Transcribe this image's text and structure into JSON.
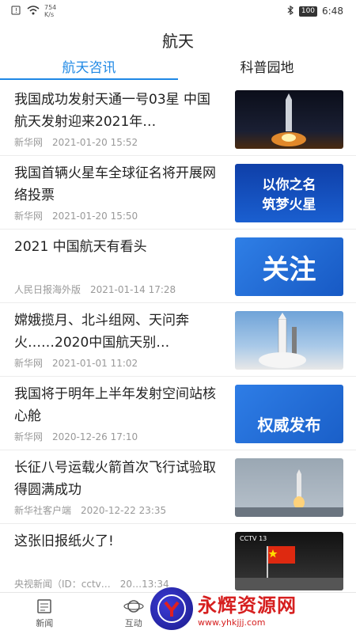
{
  "status": {
    "net_speed": "754\nK/s",
    "battery": "100",
    "time": "6:48"
  },
  "header": {
    "title": "航天"
  },
  "tabs": [
    {
      "label": "航天咨讯",
      "active": true
    },
    {
      "label": "科普园地",
      "active": false
    }
  ],
  "news": [
    {
      "title": "我国成功发射天通一号03星 中国航天发射迎来2021年…",
      "source": "新华网",
      "time": "2021-01-20 15:52"
    },
    {
      "title": "我国首辆火星车全球征名将开展网络投票",
      "source": "新华网",
      "time": "2021-01-20 15:50"
    },
    {
      "title": "2021 中国航天有看头",
      "source": "人民日报海外版",
      "time": "2021-01-14 17:28"
    },
    {
      "title": "嫦娥揽月、北斗组网、天问奔火……2020中国航天别…",
      "source": "新华网",
      "time": "2021-01-01 11:02"
    },
    {
      "title": "我国将于明年上半年发射空间站核心舱",
      "source": "新华网",
      "time": "2020-12-26 17:10"
    },
    {
      "title": "长征八号运载火箭首次飞行试验取得圆满成功",
      "source": "新华社客户端",
      "time": "2020-12-22 23:35"
    },
    {
      "title": "这张旧报纸火了!",
      "source": "央视新闻（ID：cctv…",
      "time": "20…13:34"
    }
  ],
  "thumbs": {
    "t2_main": "以你之名",
    "t2_sub": "筑梦火星",
    "t3": "关注",
    "t5": "权威发布",
    "t7_badge": "CCTV 13"
  },
  "bottom_nav": [
    {
      "label": "新闻",
      "icon": "newspaper-icon"
    },
    {
      "label": "互动",
      "icon": "planet-icon"
    }
  ],
  "watermark": {
    "main": "永辉资源网",
    "url": "www.yhkjjj.com"
  },
  "colors": {
    "accent": "#1e88e5",
    "meta": "#999999"
  }
}
